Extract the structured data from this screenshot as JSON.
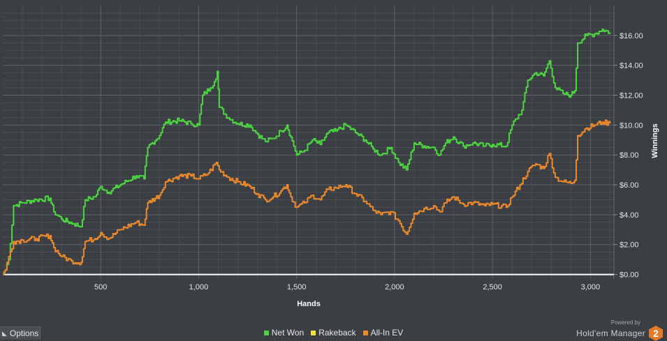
{
  "colors": {
    "net_won": "#4cd740",
    "rakeback": "#f3e23a",
    "all_in_ev": "#ee8a2c",
    "zero_line": "#ffffff",
    "grid": "#565b61",
    "background": "#3b3f44"
  },
  "options": {
    "label": "Options",
    "icon": "chevron-icon"
  },
  "branding": {
    "powered_by": "Powered by",
    "name": "Hold'em Manager",
    "badge": "2"
  },
  "chart_data": {
    "type": "line",
    "title": "",
    "xlabel": "Hands",
    "ylabel": "Winnings",
    "xlim": [
      0,
      3120
    ],
    "ylim": [
      -0.3,
      18
    ],
    "x_ticks": [
      500,
      1000,
      1500,
      2000,
      2500,
      3000
    ],
    "x_tick_labels": [
      "500",
      "1,000",
      "1,500",
      "2,000",
      "2,500",
      "3,000"
    ],
    "y_ticks": [
      0,
      2,
      4,
      6,
      8,
      10,
      12,
      14,
      16
    ],
    "y_tick_labels": [
      "$0.00",
      "$2.00",
      "$4.00",
      "$6.00",
      "$8.00",
      "$10.00",
      "$12.00",
      "$14.00",
      "$16.00"
    ],
    "y_axis_side": "right",
    "grid": true,
    "legend": "bottom-center",
    "series": [
      {
        "name": "Net Won",
        "points": [
          [
            0,
            0
          ],
          [
            12,
            0.3
          ],
          [
            30,
            1.0
          ],
          [
            55,
            4.6
          ],
          [
            100,
            4.8
          ],
          [
            170,
            5.0
          ],
          [
            240,
            5.1
          ],
          [
            260,
            4.2
          ],
          [
            300,
            3.7
          ],
          [
            360,
            3.4
          ],
          [
            400,
            3.2
          ],
          [
            420,
            5.0
          ],
          [
            470,
            5.2
          ],
          [
            500,
            5.9
          ],
          [
            540,
            5.5
          ],
          [
            600,
            6.0
          ],
          [
            680,
            6.6
          ],
          [
            720,
            6.4
          ],
          [
            740,
            8.5
          ],
          [
            800,
            9.3
          ],
          [
            830,
            10.2
          ],
          [
            900,
            10.3
          ],
          [
            960,
            10.1
          ],
          [
            1000,
            10.0
          ],
          [
            1020,
            12.0
          ],
          [
            1060,
            12.5
          ],
          [
            1080,
            12.9
          ],
          [
            1095,
            13.6
          ],
          [
            1105,
            11.2
          ],
          [
            1150,
            10.5
          ],
          [
            1200,
            10.1
          ],
          [
            1260,
            10.0
          ],
          [
            1300,
            9.4
          ],
          [
            1340,
            8.9
          ],
          [
            1380,
            9.1
          ],
          [
            1420,
            9.6
          ],
          [
            1450,
            10.0
          ],
          [
            1470,
            9.2
          ],
          [
            1500,
            8.0
          ],
          [
            1540,
            8.3
          ],
          [
            1580,
            9.0
          ],
          [
            1620,
            8.7
          ],
          [
            1660,
            9.5
          ],
          [
            1700,
            9.6
          ],
          [
            1750,
            10.0
          ],
          [
            1800,
            9.5
          ],
          [
            1850,
            9.0
          ],
          [
            1890,
            8.4
          ],
          [
            1930,
            8.0
          ],
          [
            1980,
            8.5
          ],
          [
            2020,
            7.5
          ],
          [
            2060,
            7.0
          ],
          [
            2100,
            8.8
          ],
          [
            2150,
            8.6
          ],
          [
            2200,
            8.5
          ],
          [
            2230,
            8.0
          ],
          [
            2260,
            8.8
          ],
          [
            2300,
            9.2
          ],
          [
            2350,
            8.6
          ],
          [
            2400,
            8.8
          ],
          [
            2460,
            8.6
          ],
          [
            2500,
            8.7
          ],
          [
            2570,
            8.6
          ],
          [
            2600,
            10.0
          ],
          [
            2650,
            11.0
          ],
          [
            2680,
            13.0
          ],
          [
            2720,
            13.5
          ],
          [
            2760,
            13.3
          ],
          [
            2790,
            14.3
          ],
          [
            2820,
            12.5
          ],
          [
            2860,
            12.1
          ],
          [
            2900,
            12.0
          ],
          [
            2920,
            12.3
          ],
          [
            2935,
            15.5
          ],
          [
            2980,
            16.0
          ],
          [
            3020,
            16.1
          ],
          [
            3060,
            16.4
          ],
          [
            3100,
            16.2
          ]
        ]
      },
      {
        "name": "Rakeback",
        "points": []
      },
      {
        "name": "All-In EV",
        "points": [
          [
            0,
            0
          ],
          [
            12,
            0.3
          ],
          [
            30,
            1.2
          ],
          [
            55,
            2.2
          ],
          [
            100,
            2.3
          ],
          [
            170,
            2.4
          ],
          [
            240,
            2.6
          ],
          [
            260,
            1.8
          ],
          [
            300,
            1.2
          ],
          [
            350,
            0.9
          ],
          [
            400,
            0.8
          ],
          [
            420,
            2.2
          ],
          [
            470,
            2.4
          ],
          [
            500,
            2.8
          ],
          [
            540,
            2.4
          ],
          [
            600,
            3.0
          ],
          [
            680,
            3.5
          ],
          [
            720,
            3.3
          ],
          [
            740,
            4.8
          ],
          [
            800,
            5.3
          ],
          [
            830,
            6.2
          ],
          [
            900,
            6.6
          ],
          [
            960,
            6.6
          ],
          [
            1000,
            6.4
          ],
          [
            1050,
            6.8
          ],
          [
            1090,
            7.5
          ],
          [
            1105,
            7.0
          ],
          [
            1150,
            6.5
          ],
          [
            1200,
            6.2
          ],
          [
            1260,
            5.9
          ],
          [
            1300,
            5.4
          ],
          [
            1340,
            5.0
          ],
          [
            1380,
            5.2
          ],
          [
            1420,
            5.6
          ],
          [
            1450,
            6.0
          ],
          [
            1470,
            5.2
          ],
          [
            1500,
            4.5
          ],
          [
            1540,
            4.8
          ],
          [
            1580,
            5.3
          ],
          [
            1620,
            5.0
          ],
          [
            1660,
            5.7
          ],
          [
            1700,
            5.8
          ],
          [
            1750,
            6.0
          ],
          [
            1800,
            5.4
          ],
          [
            1850,
            4.9
          ],
          [
            1890,
            4.3
          ],
          [
            1930,
            4.0
          ],
          [
            1980,
            4.2
          ],
          [
            2020,
            3.6
          ],
          [
            2060,
            2.7
          ],
          [
            2100,
            4.1
          ],
          [
            2150,
            4.4
          ],
          [
            2200,
            4.6
          ],
          [
            2230,
            4.2
          ],
          [
            2260,
            4.8
          ],
          [
            2300,
            5.2
          ],
          [
            2350,
            4.7
          ],
          [
            2400,
            4.8
          ],
          [
            2460,
            4.6
          ],
          [
            2500,
            4.7
          ],
          [
            2570,
            4.5
          ],
          [
            2600,
            5.2
          ],
          [
            2640,
            6.0
          ],
          [
            2680,
            6.9
          ],
          [
            2720,
            7.4
          ],
          [
            2760,
            7.1
          ],
          [
            2790,
            8.1
          ],
          [
            2820,
            6.5
          ],
          [
            2860,
            6.2
          ],
          [
            2900,
            6.1
          ],
          [
            2920,
            6.3
          ],
          [
            2935,
            9.3
          ],
          [
            2980,
            9.8
          ],
          [
            3020,
            10.0
          ],
          [
            3060,
            10.2
          ],
          [
            3100,
            10.1
          ]
        ]
      }
    ]
  }
}
